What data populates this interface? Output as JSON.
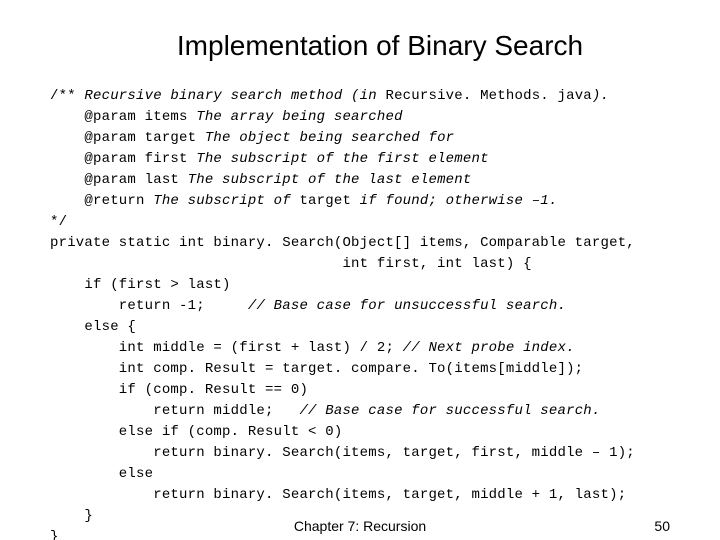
{
  "title": "Implementation of Binary Search",
  "code": {
    "l1a": "/** ",
    "l1b": "Recursive binary search method (in ",
    "l1c": "Recursive. Methods. java",
    "l1d": ").",
    "l2a": "    @param items ",
    "l2b": "The array being searched",
    "l3a": "    @param target ",
    "l3b": "The object being searched for",
    "l4a": "    @param first ",
    "l4b": "The subscript of the first element",
    "l5a": "    @param last ",
    "l5b": "The subscript of the last element",
    "l6a": "    @return ",
    "l6b": "The subscript of ",
    "l6c": "target",
    "l6d": " if found; otherwise –1.",
    "l7": "*/",
    "l8": "private static int binary. Search(Object[] items, Comparable target,",
    "l9": "                                  int first, int last) {",
    "l10": "    if (first > last)",
    "l11a": "        return -1;     ",
    "l11b": "// Base case for unsuccessful search.",
    "l12": "    else {",
    "l13a": "        int middle = (first + last) / 2; ",
    "l13b": "// Next probe index.",
    "l14": "        int comp. Result = target. compare. To(items[middle]);",
    "l15": "        if (comp. Result == 0)",
    "l16a": "            return middle;   ",
    "l16b": "// Base case for successful search.",
    "l17": "        else if (comp. Result < 0)",
    "l18": "            return binary. Search(items, target, first, middle – 1);",
    "l19": "        else",
    "l20": "            return binary. Search(items, target, middle + 1, last);",
    "l21": "    }",
    "l22": "}"
  },
  "footer": {
    "center": "Chapter 7: Recursion",
    "page": "50"
  }
}
